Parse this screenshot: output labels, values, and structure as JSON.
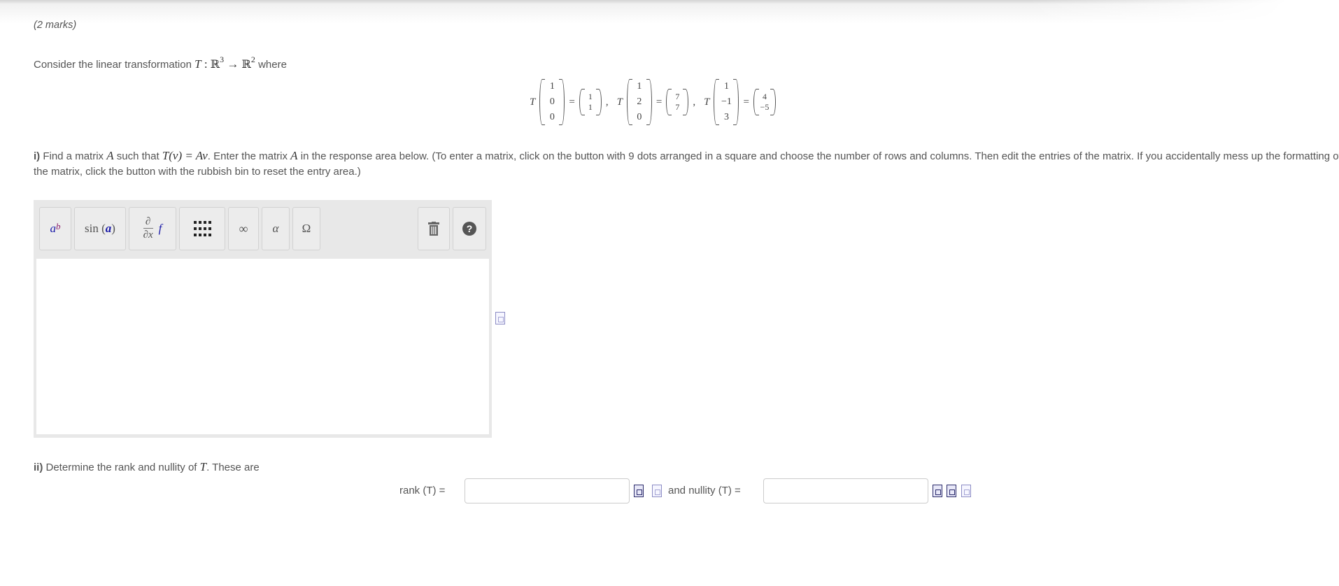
{
  "header": {
    "marks": "(2 marks)"
  },
  "intro": {
    "prefix": "Consider the linear transformation ",
    "T": "T",
    "colon": " : ",
    "domain": "ℝ",
    "domain_exp": "3",
    "arrow": " → ",
    "codomain": "ℝ",
    "codomain_exp": "2",
    "suffix": " where"
  },
  "equations": [
    {
      "input": [
        "1",
        "0",
        "0"
      ],
      "output": [
        "1",
        "1"
      ]
    },
    {
      "input": [
        "1",
        "2",
        "0"
      ],
      "output": [
        "7",
        "7"
      ]
    },
    {
      "input": [
        "1",
        "−1",
        "3"
      ],
      "output": [
        "4",
        "−5"
      ]
    }
  ],
  "symbols": {
    "T": "T",
    "equals": "=",
    "comma": ","
  },
  "question_i": {
    "label": "i)",
    "t1": " Find a matrix ",
    "A": "A",
    "t2": " such that ",
    "Tv": "T(v) = Av",
    "t3": ". Enter the matrix ",
    "t4": " in the response area below. (To enter a matrix, click on the button with 9 dots arranged in a square and choose the number of rows and columns.  Then edit the entries of the matrix.  If you accidentally mess up the formatting of the matrix, click the button with the rubbish bin to reset the entry area.)"
  },
  "toolbar": {
    "power_base": "a",
    "power_exp": "b",
    "sin_label": "sin",
    "sin_arg": "a",
    "partial_num": "∂",
    "partial_den": "∂x",
    "partial_f": "f",
    "infinity": "∞",
    "alpha": "α",
    "omega": "Ω",
    "help": "?"
  },
  "question_ii": {
    "label": "ii)",
    "t1": " Determine the rank and nullity of ",
    "T": "T",
    "t2": ". These are"
  },
  "rank": {
    "label": "rank (T) =",
    "value": ""
  },
  "nullity": {
    "label": "and nullity (T) =",
    "value": ""
  }
}
